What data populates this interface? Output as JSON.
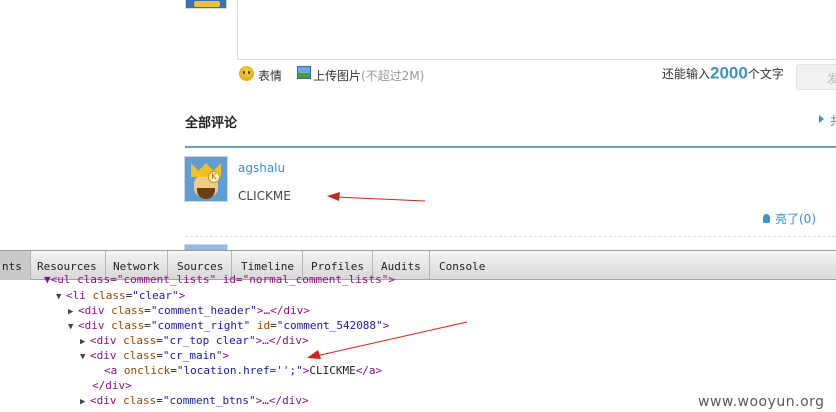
{
  "editor": {
    "emoji_label": "表情",
    "upload_label": "上传图片",
    "upload_hint": "(不超过2M)",
    "count_prefix": "还能输入",
    "count_value": "2000",
    "count_suffix": "个文字",
    "submit_label": "发"
  },
  "comments": {
    "section_title": "全部评论",
    "more_label": "共",
    "items": [
      {
        "username": "agshalu",
        "text": "CLICKME",
        "like_label": "亮了(0)"
      }
    ]
  },
  "devtools": {
    "tabs": [
      "nts",
      "Resources",
      "Network",
      "Sources",
      "Timeline",
      "Profiles",
      "Audits",
      "Console"
    ],
    "active_tab": "Elements",
    "lines": {
      "l0": {
        "prefix": "▼<ul class=\"comment_lists\" id=\"normal_comment_lists\">"
      },
      "l1": {
        "tag_open": "<li",
        "attr": "class",
        "val": "\"clear\"",
        "close": ">"
      },
      "l2": {
        "tag_open": "<div",
        "attr": "class",
        "val": "\"comment_header\"",
        "close": ">…</div>"
      },
      "l3": {
        "tag_open": "<div",
        "attr": "class",
        "val": "\"comment_right\"",
        "attr2": "id",
        "val2": "\"comment_542088\"",
        "close": ">"
      },
      "l4": {
        "tag_open": "<div",
        "attr": "class",
        "val": "\"cr_top clear\"",
        "close": ">…</div>"
      },
      "l5": {
        "tag_open": "<div",
        "attr": "class",
        "val": "\"cr_main\"",
        "close": ">"
      },
      "l6": {
        "tag_open": "<a",
        "attr": "onclick",
        "val": "\"location.href='';\"",
        "close_a": ">",
        "text": "CLICKME",
        "end": "</a>"
      },
      "l7": {
        "end": "</div>"
      },
      "l8": {
        "tag_open": "<div",
        "attr": "class",
        "val": "\"comment_btns\"",
        "close": ">…</div>"
      }
    }
  },
  "watermark": "www.wooyun.org",
  "colors": {
    "link": "#3a8fcf",
    "annotation_arrow": "#d42020",
    "tag": "#881280",
    "attr": "#994500",
    "value": "#1a1aa6"
  }
}
